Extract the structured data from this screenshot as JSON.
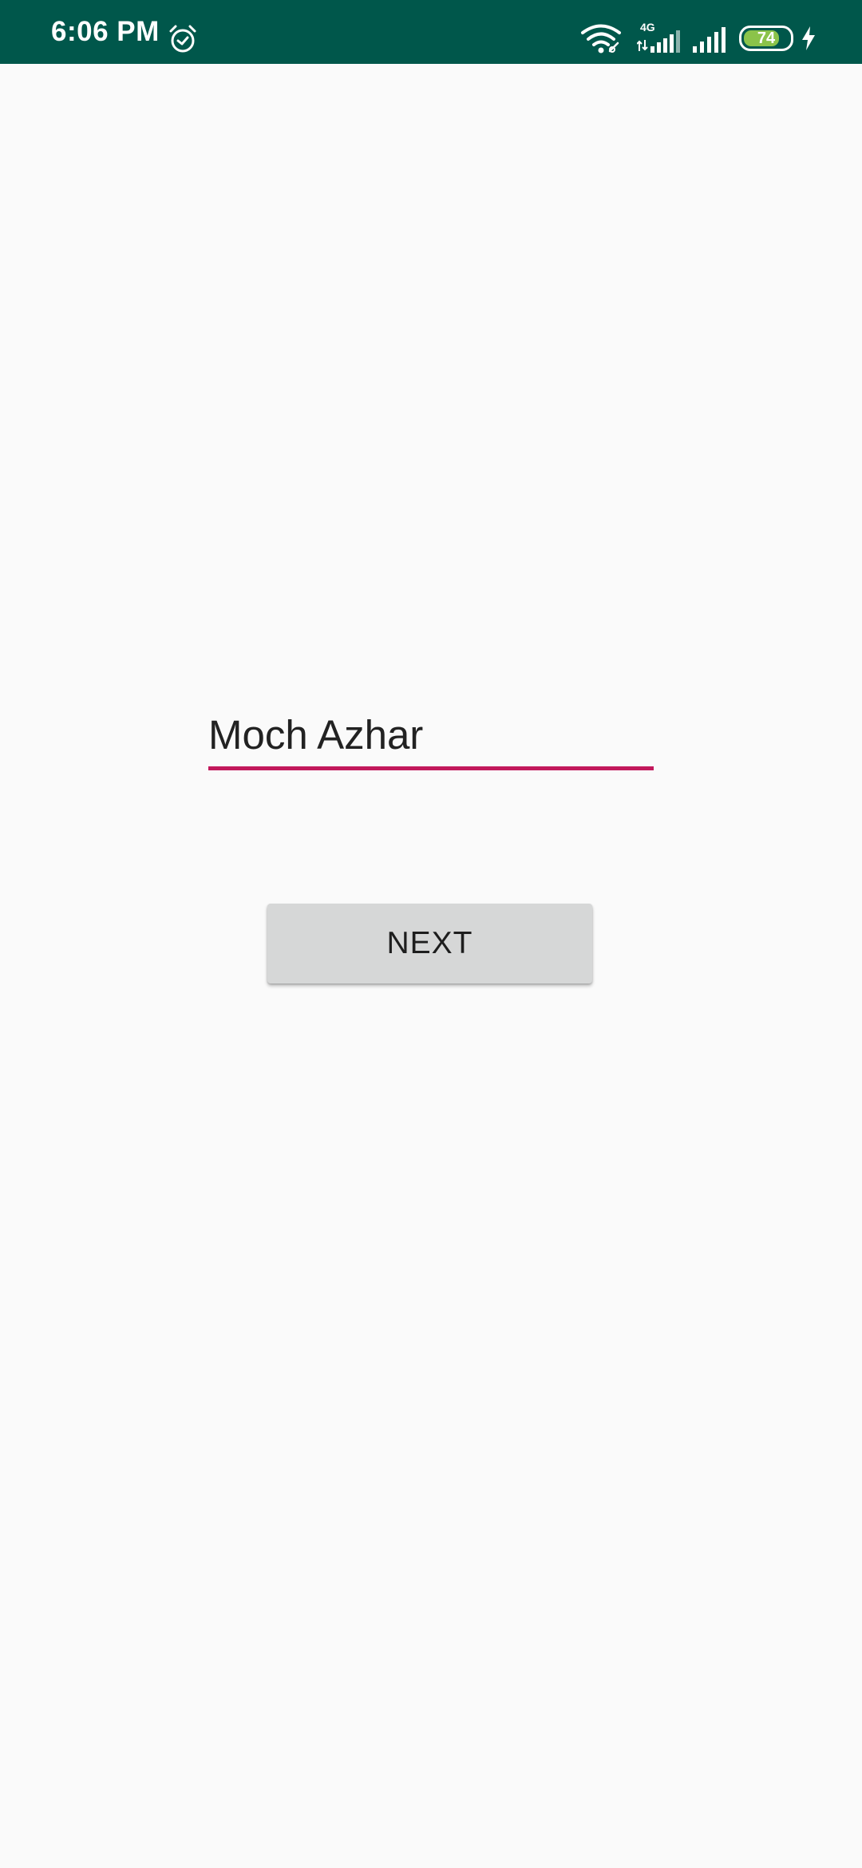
{
  "status_bar": {
    "time": "6:06 PM",
    "network_type": "4G",
    "battery_level": "74",
    "background_color": "#00574B",
    "icons": [
      "alarm-icon",
      "wifi-icon",
      "cell-4g-icon",
      "signal-icon",
      "battery-icon",
      "charging-icon"
    ]
  },
  "form": {
    "name_input_value": "Moch Azhar",
    "underline_color": "#C2185B"
  },
  "next_button": {
    "label": "NEXT"
  }
}
